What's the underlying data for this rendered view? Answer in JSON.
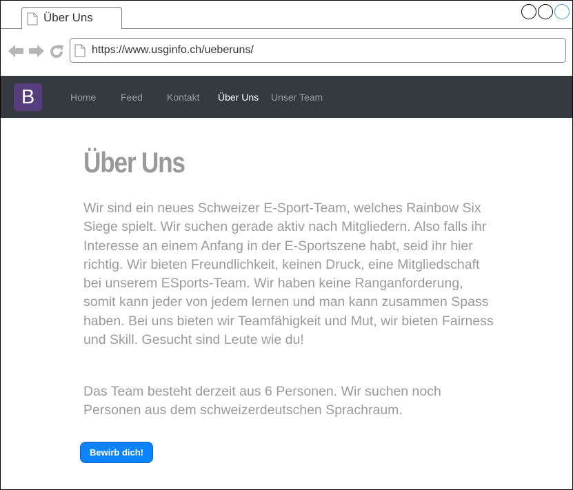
{
  "browser": {
    "tab_title": "Über Uns",
    "url": "https://www.usginfo.ch/ueberuns/"
  },
  "navbar": {
    "brand": "B",
    "links": [
      {
        "label": "Home",
        "active": false
      },
      {
        "label": "Feed",
        "active": false
      },
      {
        "label": "Kontakt",
        "active": false
      },
      {
        "label": "Über Uns",
        "active": true
      },
      {
        "label": "Unser Team",
        "active": false
      }
    ]
  },
  "main": {
    "title": "Über Uns",
    "paragraph_1": "Wir sind ein neues Schweizer E-Sport-Team, welches Rainbow Six Siege spielt. Wir suchen gerade aktiv nach Mitgliedern. Also falls ihr Interesse an einem Anfang in der E-Sportszene habt, seid ihr hier richtig. Wir bieten Freundlichkeit, keinen Druck, eine Mitgliedschaft bei unserem ESports-Team. Wir haben keine Ranganforderung, somit kann jeder von jedem lernen und man kann zusammen Spass haben. Bei uns bieten wir Teamfähigkeit und Mut, wir bieten Fairness und Skill. Gesucht sind Leute wie du!",
    "paragraph_2": "Das Team besteht derzeit aus 6 Personen. Wir suchen noch Personen aus dem schweizerdeutschen Sprachraum.",
    "cta_label": "Bewirb dich!"
  },
  "colors": {
    "navbar_bg": "#343a40",
    "brand_bg": "#563d7c",
    "button_bg": "#0d84ff",
    "text_muted": "#9a9a9a"
  }
}
